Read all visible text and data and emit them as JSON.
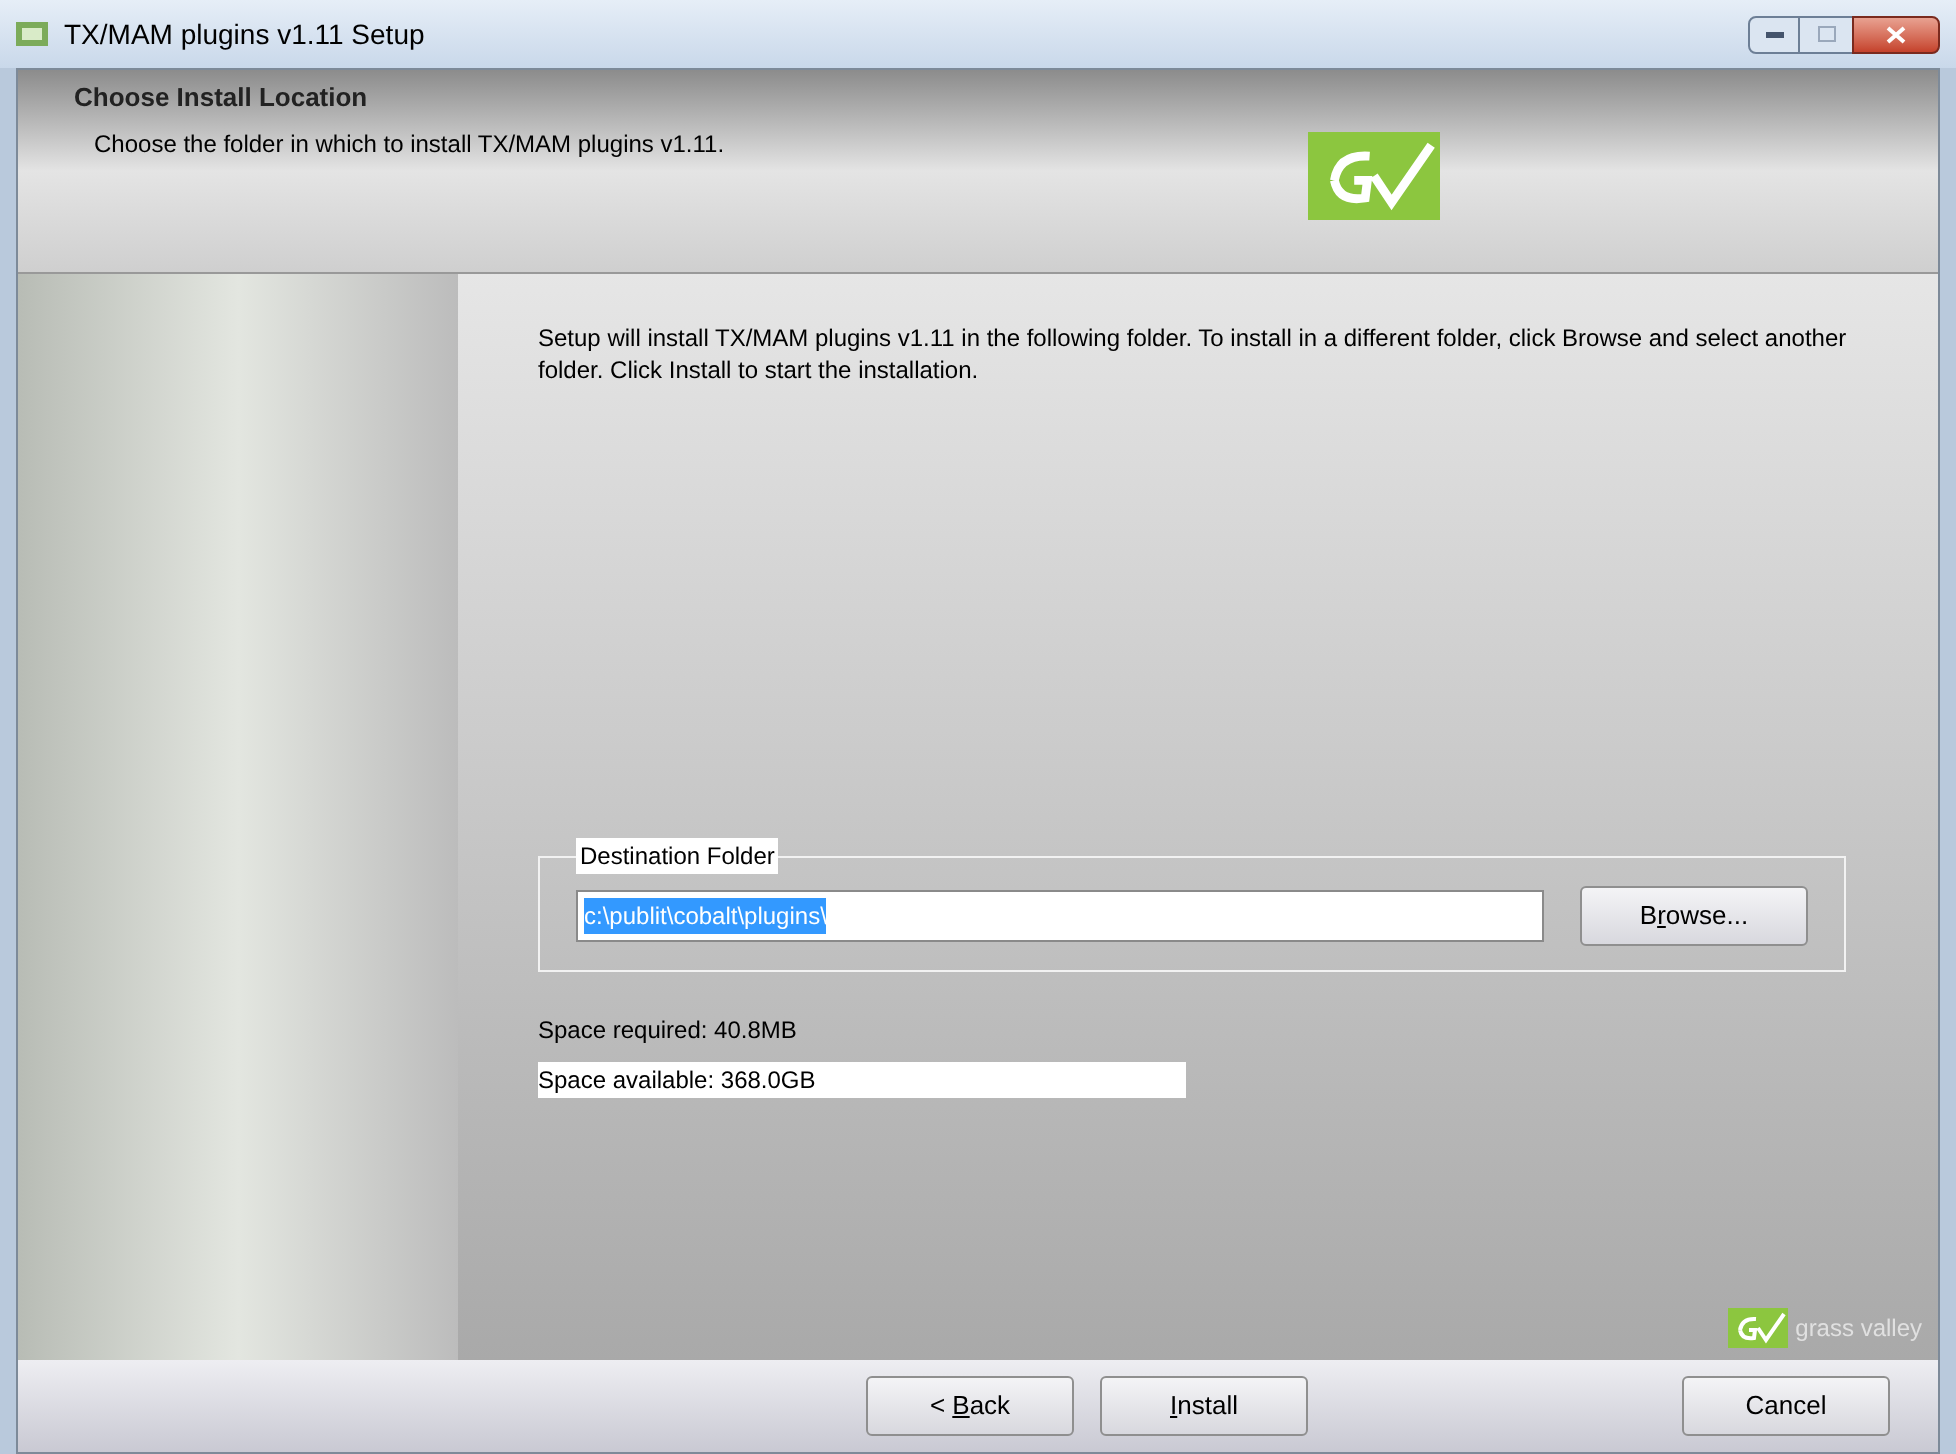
{
  "window": {
    "title": "TX/MAM plugins v1.11 Setup"
  },
  "header": {
    "title": "Choose Install Location",
    "subtitle": "Choose the folder in which to install TX/MAM plugins v1.11."
  },
  "intro": "Setup will install TX/MAM plugins v1.11 in the following folder. To install in a different folder, click Browse and select another folder. Click Install to start the installation.",
  "destination": {
    "legend": "Destination Folder",
    "value": "c:\\publit\\cobalt\\plugins\\",
    "selected": true,
    "browse": {
      "before": "B",
      "access_key": "r",
      "after": "owse..."
    }
  },
  "space_required": "Space required: 40.8MB",
  "space_available": "Space available: 368.0GB",
  "brand": "grass valley",
  "buttons": [
    {
      "before": "< ",
      "access_key": "B",
      "after": "ack"
    },
    {
      "access_key": "I",
      "after": "nstall"
    },
    {
      "before": "Cancel"
    }
  ]
}
